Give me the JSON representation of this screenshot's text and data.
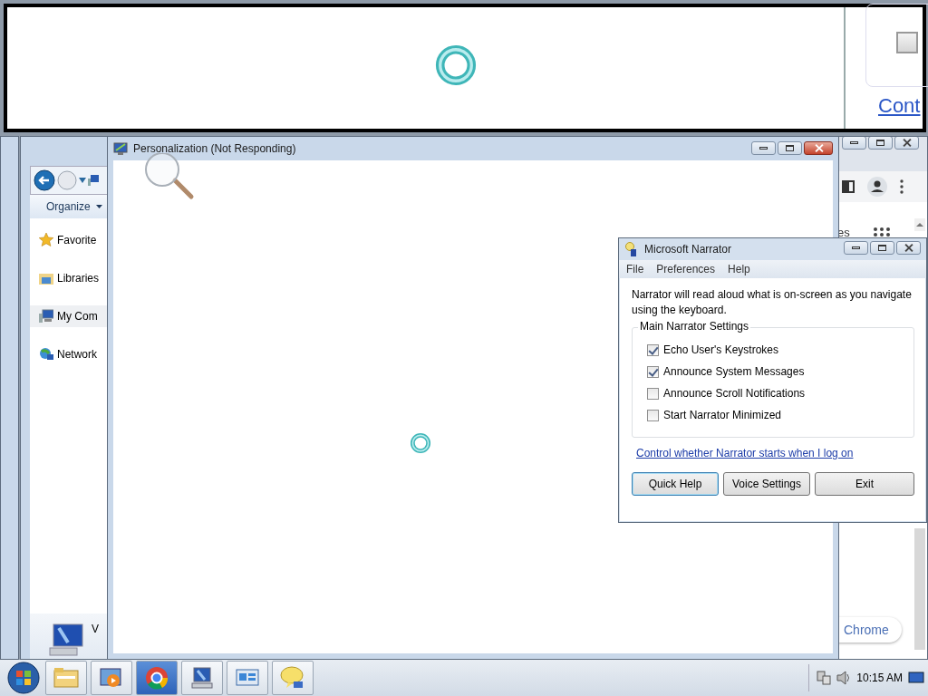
{
  "top_window": {
    "busy": true,
    "checkbox": {
      "checked": false
    },
    "link": "Cont"
  },
  "explorer": {
    "organize": "Organize",
    "nav_items": [
      {
        "kind": "star",
        "label": "Favorite",
        "selected": false
      },
      {
        "kind": "library",
        "label": "Libraries",
        "selected": false
      },
      {
        "kind": "computer",
        "label": "My Com",
        "selected": true
      },
      {
        "kind": "network",
        "label": "Network",
        "selected": false
      }
    ],
    "details_label": "V"
  },
  "personalization": {
    "title": "Personalization (Not Responding)",
    "busy": true
  },
  "chrome": {
    "text": "es",
    "button": "Chrome"
  },
  "narrator": {
    "title": "Microsoft Narrator",
    "menu": [
      "File",
      "Preferences",
      "Help"
    ],
    "description": "Narrator will read aloud what is on-screen as you navigate using the keyboard.",
    "group_title": "Main Narrator Settings",
    "options": [
      {
        "label": "Echo User's Keystrokes",
        "checked": true
      },
      {
        "label": "Announce System Messages",
        "checked": true
      },
      {
        "label": "Announce Scroll Notifications",
        "checked": false
      },
      {
        "label": "Start Narrator Minimized",
        "checked": false
      }
    ],
    "link": "Control whether Narrator starts when I log on",
    "buttons": [
      {
        "label": "Quick Help",
        "focused": true
      },
      {
        "label": "Voice Settings",
        "focused": false
      },
      {
        "label": "Exit",
        "focused": false
      }
    ]
  },
  "taskbar": {
    "items": [
      {
        "kind": "folder",
        "active": false
      },
      {
        "kind": "media",
        "active": false
      },
      {
        "kind": "chrome",
        "active": true
      },
      {
        "kind": "computer",
        "active": false
      },
      {
        "kind": "remote",
        "active": false
      },
      {
        "kind": "chat",
        "active": false
      }
    ],
    "clock": "10:15 AM"
  }
}
